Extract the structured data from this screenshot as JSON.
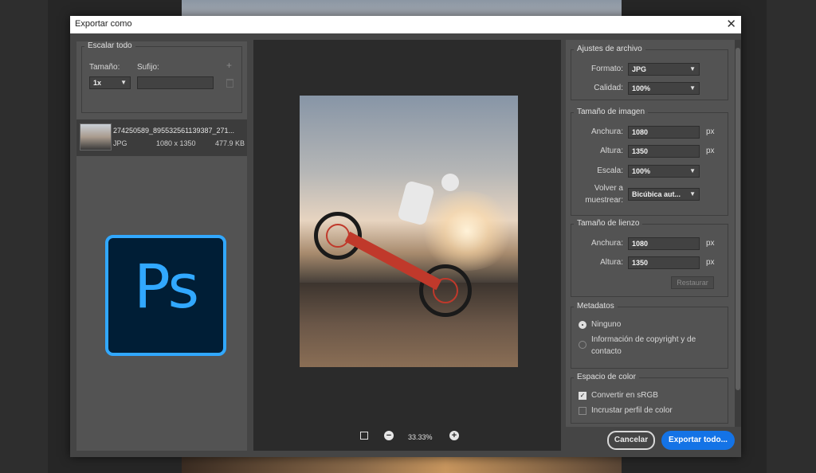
{
  "dialog": {
    "title": "Exportar como",
    "close_glyph": "✕"
  },
  "scale_all": {
    "heading": "Escalar todo",
    "size_label": "Tamaño:",
    "suffix_label": "Sufijo:",
    "size_value": "1x",
    "suffix_value": "",
    "add_glyph": "+"
  },
  "asset": {
    "name": "274250589_895532561139387_271...",
    "type": "JPG",
    "dimensions": "1080 x 1350",
    "file_size": "477.9 KB"
  },
  "logo": {
    "text": "Ps",
    "bg_color": "#001e36",
    "accent_color": "#31a8ff"
  },
  "zoom": {
    "level": "33.33%",
    "minus": "−",
    "plus": "+"
  },
  "file_settings": {
    "heading": "Ajustes de archivo",
    "format_label": "Formato:",
    "format_value": "JPG",
    "quality_label": "Calidad:",
    "quality_value": "100%"
  },
  "image_size": {
    "heading": "Tamaño de imagen",
    "width_label": "Anchura:",
    "width_value": "1080",
    "height_label": "Altura:",
    "height_value": "1350",
    "unit": "px",
    "scale_label": "Escala:",
    "scale_value": "100%",
    "resample_label_1": "Volver a",
    "resample_label_2": "muestrear:",
    "resample_value": "Bicúbica aut..."
  },
  "canvas_size": {
    "heading": "Tamaño de lienzo",
    "width_label": "Anchura:",
    "width_value": "1080",
    "height_label": "Altura:",
    "height_value": "1350",
    "unit": "px",
    "restore_label": "Restaurar"
  },
  "metadata": {
    "heading": "Metadatos",
    "option_none": "Ninguno",
    "option_copyright_1": "Información de copyright y de",
    "option_copyright_2": "contacto",
    "selected": "Ninguno"
  },
  "color_space": {
    "heading": "Espacio de color",
    "convert_srgb": "Convertir en sRGB",
    "convert_srgb_checked": true,
    "embed_profile": "Incrustar perfil de color",
    "embed_profile_checked": false
  },
  "actions": {
    "cancel": "Cancelar",
    "export": "Exportar todo..."
  },
  "colors": {
    "accent": "#1473e6",
    "panel": "#535353",
    "dialog": "#454545"
  }
}
